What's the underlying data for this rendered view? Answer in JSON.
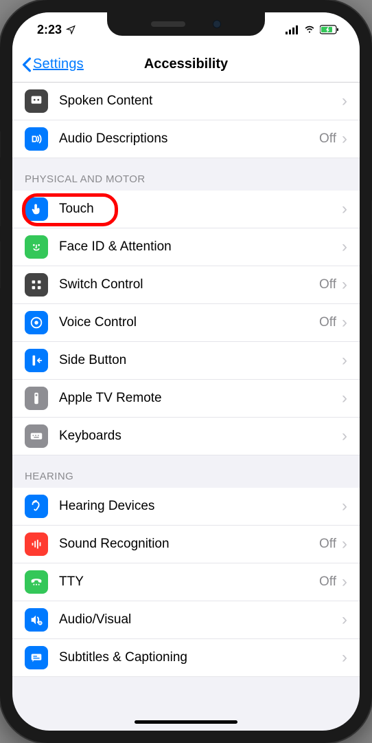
{
  "status": {
    "time": "2:23"
  },
  "nav": {
    "back": "Settings",
    "title": "Accessibility"
  },
  "rows": {
    "spoken": "Spoken Content",
    "audio_desc": "Audio Descriptions",
    "audio_desc_val": "Off",
    "touch": "Touch",
    "faceid": "Face ID & Attention",
    "switch": "Switch Control",
    "switch_val": "Off",
    "voice": "Voice Control",
    "voice_val": "Off",
    "side": "Side Button",
    "atv": "Apple TV Remote",
    "kb": "Keyboards",
    "hearing": "Hearing Devices",
    "sound": "Sound Recognition",
    "sound_val": "Off",
    "tty": "TTY",
    "tty_val": "Off",
    "av": "Audio/Visual",
    "subs": "Subtitles & Captioning"
  },
  "sections": {
    "phys": "PHYSICAL AND MOTOR",
    "hearing": "HEARING"
  }
}
